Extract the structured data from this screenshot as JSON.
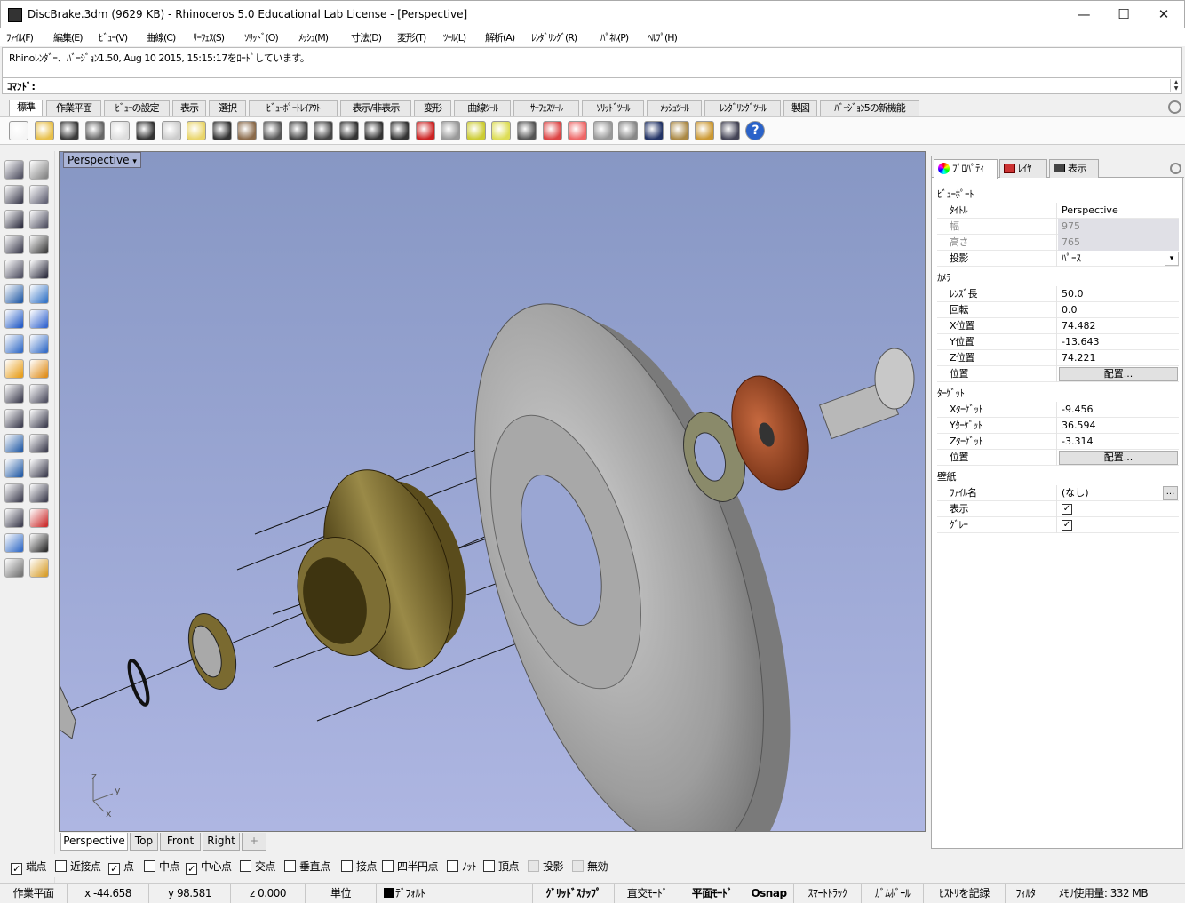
{
  "window": {
    "title": "DiscBrake.3dm (9629 KB) - Rhinoceros 5.0 Educational Lab License - [Perspective]",
    "minimize": "—",
    "maximize": "☐",
    "close": "✕"
  },
  "menu": [
    "ﾌｧｲﾙ(F)",
    "編集(E)",
    "ﾋﾞｭｰ(V)",
    "曲線(C)",
    "ｻｰﾌｪｽ(S)",
    "ｿﾘｯﾄﾞ(O)",
    "ﾒｯｼｭ(M)",
    "寸法(D)",
    "変形(T)",
    "ﾂｰﾙ(L)",
    "解析(A)",
    "ﾚﾝﾀﾞﾘﾝｸﾞ(R)",
    "ﾊﾟﾈﾙ(P)",
    "ﾍﾙﾌﾟ(H)"
  ],
  "history": "Rhinoﾚﾝﾀﾞｰ、ﾊﾞｰｼﾞｮﾝ1.50, Aug 10 2015, 15:15:17をﾛｰﾄﾞしています。",
  "command_label": "ｺﾏﾝﾄﾞ:",
  "toolbar_tabs": [
    "標準",
    "作業平面",
    "ﾋﾞｭｰの設定",
    "表示",
    "選択",
    "ﾋﾞｭｰﾎﾟｰﾄﾚｲｱｳﾄ",
    "表示/非表示",
    "変形",
    "曲線ﾂｰﾙ",
    "ｻｰﾌｪｽﾂｰﾙ",
    "ｿﾘｯﾄﾞﾂｰﾙ",
    "ﾒｯｼｭﾂｰﾙ",
    "ﾚﾝﾀﾞﾘﾝｸﾞﾂｰﾙ",
    "製図",
    "ﾊﾞｰｼﾞｮﾝ5の新機能"
  ],
  "toolbar_icons": [
    "new-icon",
    "open-icon",
    "save-icon",
    "print-icon",
    "import-icon",
    "cut-icon",
    "copy-icon",
    "paste-icon",
    "undo-icon",
    "pan-icon",
    "rotate-view-icon",
    "zoom-icon",
    "zoom-window-icon",
    "zoom-extents-icon",
    "zoom-selected-icon",
    "four-viewports-icon",
    "car-icon",
    "cplane-icon",
    "gumball-icon",
    "light-icon",
    "lock-icon",
    "layer-icon",
    "color-wheel-icon",
    "shaded-sphere-icon",
    "rendered-sphere-icon",
    "render-icon",
    "material-icon",
    "options-gear-icon",
    "snap-icon",
    "help-icon"
  ],
  "viewport": {
    "label": "Perspective",
    "axis_x": "x",
    "axis_y": "y",
    "axis_z": "z",
    "tabs": [
      "Perspective",
      "Top",
      "Front",
      "Right",
      "+"
    ]
  },
  "panel": {
    "tabs": [
      "ﾌﾟﾛﾊﾟﾃｨ",
      "ﾚｲﾔ",
      "表示"
    ],
    "viewport_section": "ﾋﾞｭｰﾎﾟｰﾄ",
    "title_k": "ﾀｲﾄﾙ",
    "title_v": "Perspective",
    "width_k": "幅",
    "width_v": "975",
    "height_k": "高さ",
    "height_v": "765",
    "proj_k": "投影",
    "proj_v": "ﾊﾟｰｽ",
    "camera_section": "ｶﾒﾗ",
    "lens_k": "ﾚﾝｽﾞ長",
    "lens_v": "50.0",
    "rot_k": "回転",
    "rot_v": "0.0",
    "xpos_k": "X位置",
    "xpos_v": "74.482",
    "ypos_k": "Y位置",
    "ypos_v": "-13.643",
    "zpos_k": "Z位置",
    "zpos_v": "74.221",
    "pos_k": "位置",
    "place_btn": "配置...",
    "target_section": "ﾀｰｹﾞｯﾄ",
    "xt_k": "Xﾀｰｹﾞｯﾄ",
    "xt_v": "-9.456",
    "yt_k": "Yﾀｰｹﾞｯﾄ",
    "yt_v": "36.594",
    "zt_k": "Zﾀｰｹﾞｯﾄ",
    "zt_v": "-3.314",
    "tpos_k": "位置",
    "wall_section": "壁紙",
    "file_k": "ﾌｧｲﾙ名",
    "file_v": "(なし)",
    "show_k": "表示",
    "gray_k": "ｸﾞﾚｰ",
    "browse": "..."
  },
  "osnap": [
    {
      "label": "端点",
      "checked": true
    },
    {
      "label": "近接点",
      "checked": false
    },
    {
      "label": "点",
      "checked": true
    },
    {
      "label": "中点",
      "checked": false
    },
    {
      "label": "中心点",
      "checked": true
    },
    {
      "label": "交点",
      "checked": false
    },
    {
      "label": "垂直点",
      "checked": false
    },
    {
      "label": "接点",
      "checked": false
    },
    {
      "label": "四半円点",
      "checked": false
    },
    {
      "label": "ﾉｯﾄ",
      "checked": false
    },
    {
      "label": "頂点",
      "checked": false
    },
    {
      "label": "投影",
      "checked": false
    },
    {
      "label": "無効",
      "checked": false
    }
  ],
  "status": {
    "cplane": "作業平面",
    "x": "x -44.658",
    "y": "y 98.581",
    "z": "z 0.000",
    "units": "単位",
    "layer": "ﾃﾞﾌｫﾙﾄ",
    "grid_snap": "ｸﾞﾘｯﾄﾞｽﾅｯﾌﾟ",
    "ortho": "直交ﾓｰﾄﾞ",
    "planar": "平面ﾓｰﾄﾞ",
    "osnap": "Osnap",
    "smarttrack": "ｽﾏｰﾄﾄﾗｯｸ",
    "gumball": "ｶﾞﾑﾎﾞｰﾙ",
    "history": "ﾋｽﾄﾘを記録",
    "filter": "ﾌｨﾙﾀ",
    "memory": "ﾒﾓﾘ使用量: 332 MB"
  },
  "colors": {
    "viewport_bg": "#98a4d2",
    "disc": "#b4b4b4",
    "hub": "#7a6a30",
    "spacer": "#b0502a"
  }
}
